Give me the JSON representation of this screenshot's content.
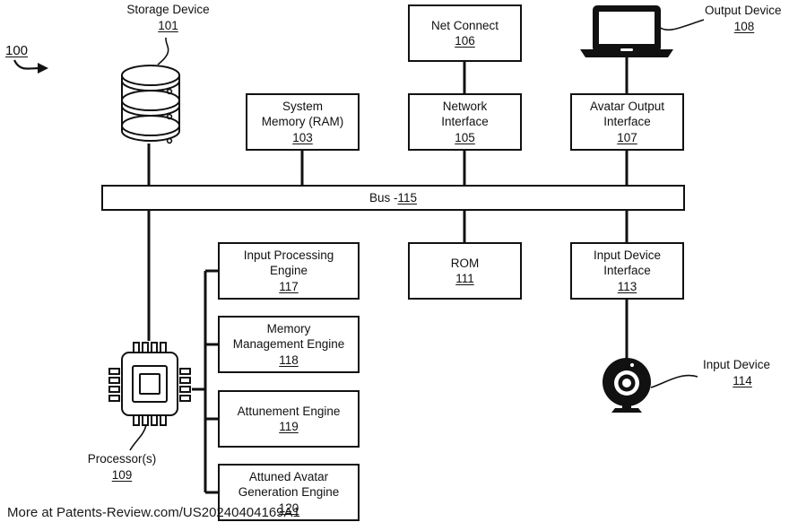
{
  "figure": {
    "figure_ref": "100",
    "watermark": "More at Patents-Review.com/US20240404169A1",
    "line_color": "#111111",
    "background": "#ffffff"
  },
  "bus": {
    "label": "Bus - ",
    "ref": "115"
  },
  "boxes": {
    "system_memory": {
      "line1": "System",
      "line2": "Memory (RAM)",
      "ref": "103"
    },
    "net_connect": {
      "line1": "Net Connect",
      "ref": "106"
    },
    "network_interface": {
      "line1": "Network",
      "line2": "Interface",
      "ref": "105"
    },
    "avatar_output_interface": {
      "line1": "Avatar Output",
      "line2": "Interface",
      "ref": "107"
    },
    "rom": {
      "line1": "ROM",
      "ref": "111"
    },
    "input_device_interface": {
      "line1": "Input Device",
      "line2": "Interface",
      "ref": "113"
    },
    "input_processing_engine": {
      "line1": "Input Processing",
      "line2": "Engine",
      "ref": "117"
    },
    "memory_management_engine": {
      "line1": "Memory",
      "line2": "Management Engine",
      "ref": "118"
    },
    "attunement_engine": {
      "line1": "Attunement Engine",
      "ref": "119"
    },
    "attuned_avatar_generation_engine": {
      "line1": "Attuned Avatar",
      "line2": "Generation Engine",
      "ref": "120"
    }
  },
  "callouts": {
    "storage_device": {
      "label": "Storage Device",
      "ref": "101",
      "icon": "database-cylinder-icon"
    },
    "output_device": {
      "label": "Output Device",
      "ref": "108",
      "icon": "laptop-icon"
    },
    "input_device": {
      "label": "Input Device",
      "ref": "114",
      "icon": "webcam-icon"
    },
    "processor": {
      "label": "Processor(s)",
      "ref": "109",
      "icon": "cpu-chip-icon"
    }
  }
}
